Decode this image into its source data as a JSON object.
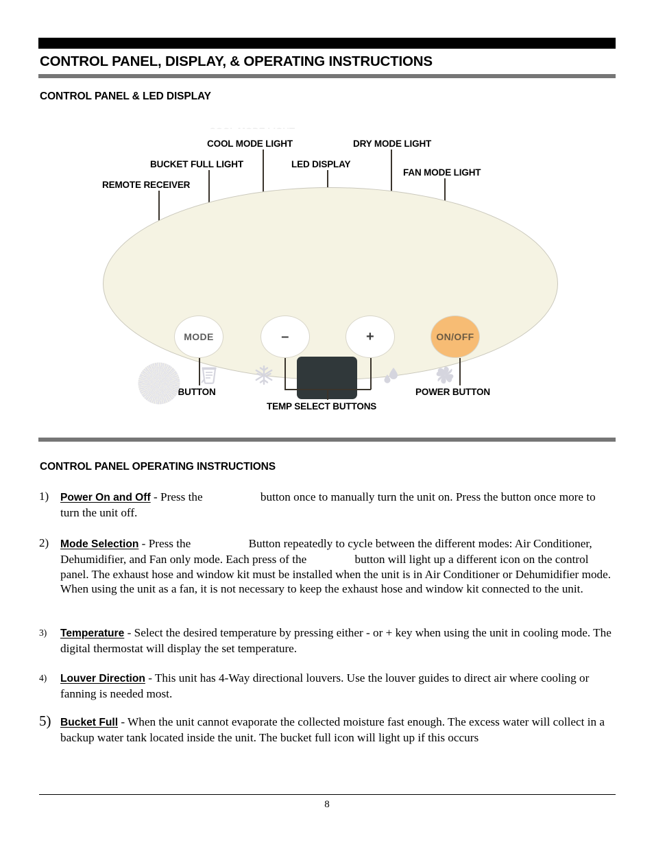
{
  "document": {
    "title": "CONTROL PANEL, DISPLAY, & OPERATING INSTRUCTIONS",
    "page_number": "8"
  },
  "sections": {
    "diagram_heading": "CONTROL PANEL & LED DISPLAY",
    "instructions_heading": "CONTROL PANEL OPERATING INSTRUCTIONS"
  },
  "diagram": {
    "ghost_label": "COOL MODE LIGHT",
    "callouts": {
      "remote_receiver": "REMOTE RECEIVER",
      "bucket_full_light": "BUCKET FULL LIGHT",
      "cool_mode_light": "COOL MODE LIGHT",
      "led_display": "LED DISPLAY",
      "dry_mode_light": "DRY MODE LIGHT",
      "fan_mode_light": "FAN MODE LIGHT",
      "mode_button": "MODE BUTTON",
      "temp_select_buttons": "TEMP SELECT BUTTONS",
      "power_button": "POWER BUTTON"
    },
    "buttons": {
      "mode": "MODE",
      "minus": "–",
      "plus": "+",
      "power": "ON/OFF"
    },
    "colors": {
      "panel_fill": "#f5f3e3",
      "panel_border": "#c9c7bb",
      "led_display": "#30383a",
      "power_button": "#f7bc74",
      "icon_gray": "#d8d8e0"
    },
    "icon_names": [
      "remote-receiver-icon",
      "bucket-full-icon",
      "snowflake-icon",
      "water-droplets-icon",
      "fan-blade-icon"
    ]
  },
  "instructions": [
    {
      "number": "1)",
      "term": "Power On and Off",
      "text_before_gap": " - Press the ",
      "text_after_gap": "button once to manually turn the unit on. Press the button once more to turn the unit off."
    },
    {
      "number": "2)",
      "term": "Mode Selection",
      "text_before_gap": " - Press the ",
      "text_mid_1": "Button repeatedly to cycle between the different modes: Air Conditioner, Dehumidifier, and Fan only mode. Each press of the ",
      "text_mid_2": "button will light up a different icon on the control panel. The exhaust hose and window kit must be installed when the unit is in Air Conditioner or Dehumidifier mode. When using the unit as a fan, it is not necessary to keep the exhaust hose and window kit connected to the unit."
    },
    {
      "number": "3)",
      "term": "Temperature",
      "text": " - Select the desired temperature by pressing either - or +  key when using the unit in cooling mode. The digital thermostat will display the set temperature."
    },
    {
      "number": "4)",
      "term": "Louver Direction",
      "text": " - This unit has 4-Way directional louvers. Use the louver guides to direct air where cooling or fanning is needed most."
    },
    {
      "number": "5)",
      "term": "Bucket Full",
      "text": " - When the unit cannot evaporate the collected moisture fast enough. The excess water will collect in a backup water tank located inside the unit. The bucket full icon will light up if this occurs"
    }
  ]
}
